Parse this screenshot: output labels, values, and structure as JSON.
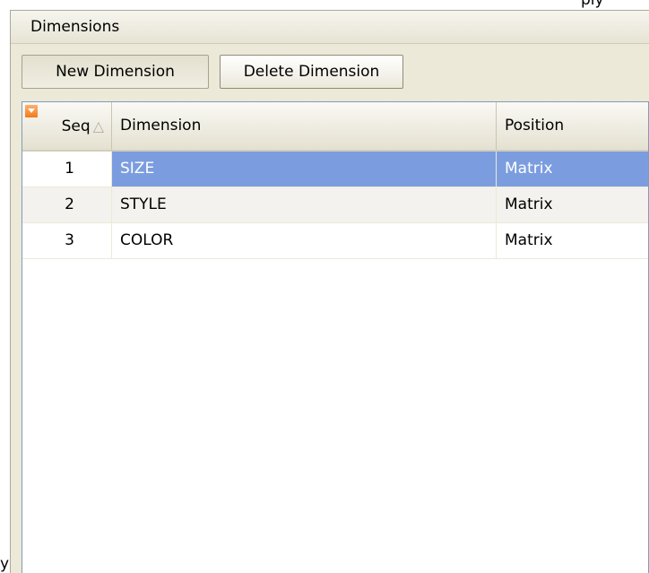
{
  "edge_fragments": {
    "top_right": "ply",
    "bottom_left": "y"
  },
  "panel": {
    "title": "Dimensions"
  },
  "toolbar": {
    "new_label": "New Dimension",
    "delete_label": "Delete Dimension"
  },
  "grid": {
    "columns": {
      "seq": "Seq",
      "dimension": "Dimension",
      "position": "Position"
    },
    "sort_indicator": "△",
    "rows": [
      {
        "seq": "1",
        "dimension": "SIZE",
        "position": "Matrix",
        "selected": true
      },
      {
        "seq": "2",
        "dimension": "STYLE",
        "position": "Matrix",
        "selected": false
      },
      {
        "seq": "3",
        "dimension": "COLOR",
        "position": "Matrix",
        "selected": false
      }
    ]
  },
  "colors": {
    "selection": "#7b9de0",
    "panel_bg": "#ece9d8",
    "grid_border": "#7f9db9",
    "menu_corner": "#f07a1c"
  }
}
